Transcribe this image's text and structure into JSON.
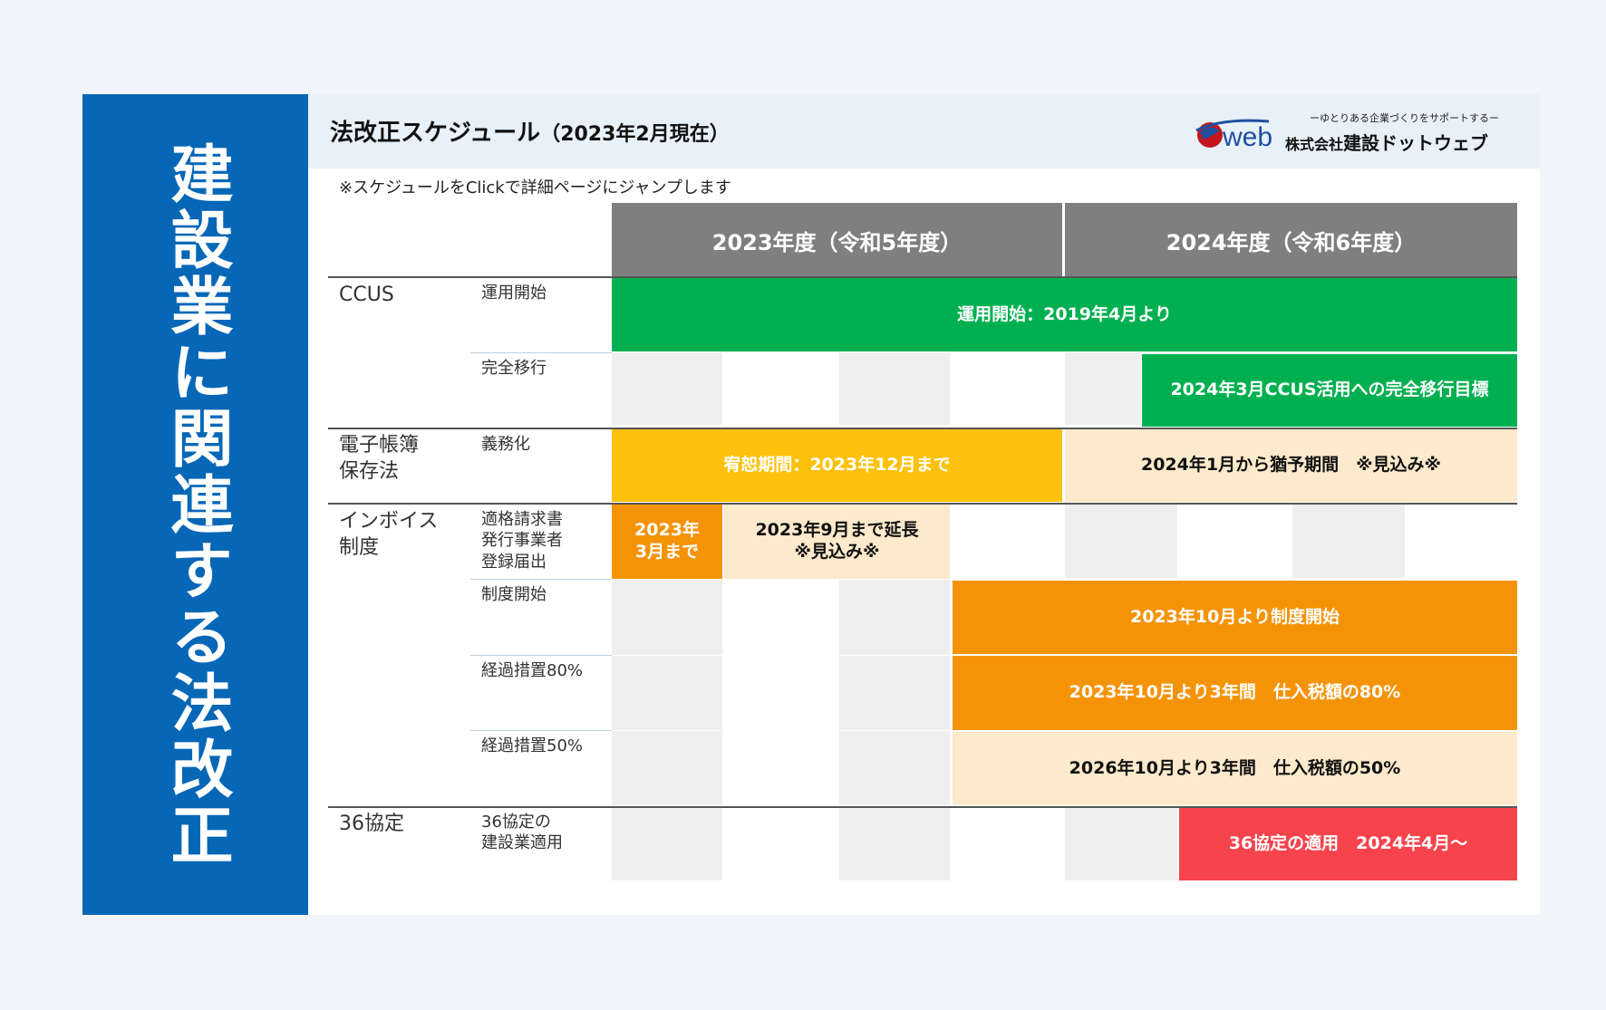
{
  "side_title": "建設業に関連する法改正",
  "header": {
    "title": "法改正スケジュール",
    "subtitle": "（2023年2月現在）"
  },
  "logo": {
    "mark_text": "web",
    "tagline": "ーゆとりある企業づくりをサポートするー",
    "company_prefix": "株式会社",
    "company_name": "建設ドットウェブ"
  },
  "note": "※スケジュールをClickで詳細ページにジャンプします",
  "years": [
    "2023年度（令和5年度）",
    "2024年度（令和6年度）"
  ],
  "categories": {
    "ccus": "CCUS",
    "denshi_1": "電子帳簿",
    "denshi_2": "保存法",
    "invoice_1": "インボイス",
    "invoice_2": "制度",
    "kyotei": "36協定"
  },
  "sub_labels": {
    "ccus_start": "運用開始",
    "ccus_full": "完全移行",
    "denshi_duty": "義務化",
    "invoice_reg_1": "適格請求書",
    "invoice_reg_2": "発行事業者",
    "invoice_reg_3": "登録届出",
    "invoice_start": "制度開始",
    "invoice_80": "経過措置80%",
    "invoice_50": "経過措置50%",
    "kyotei_1": "36協定の",
    "kyotei_2": "建設業適用"
  },
  "bars": {
    "ccus_start": "運用開始：2019年4月より",
    "ccus_full": "2024年3月CCUS活用への完全移行目標",
    "denshi_grace": "宥恕期間：2023年12月まで",
    "denshi_after": "2024年1月から猶予期間　※見込み※",
    "invoice_reg_1": "2023年",
    "invoice_reg_2": "3月まで",
    "invoice_ext_1": "2023年9月まで延長",
    "invoice_ext_2": "※見込み※",
    "invoice_start": "2023年10月より制度開始",
    "invoice_80": "2023年10月より3年間　仕入税額の80%",
    "invoice_50": "2026年10月より3年間　仕入税額の50%",
    "kyotei": "36協定の適用　2024年4月～"
  },
  "colors": {
    "side_blue": "#0667b7",
    "green": "#00b050",
    "yellow": "#fcc10c",
    "cream": "#fde9cb",
    "orange": "#f59307",
    "red": "#f7434c",
    "year_header": "#7f7f7f"
  }
}
